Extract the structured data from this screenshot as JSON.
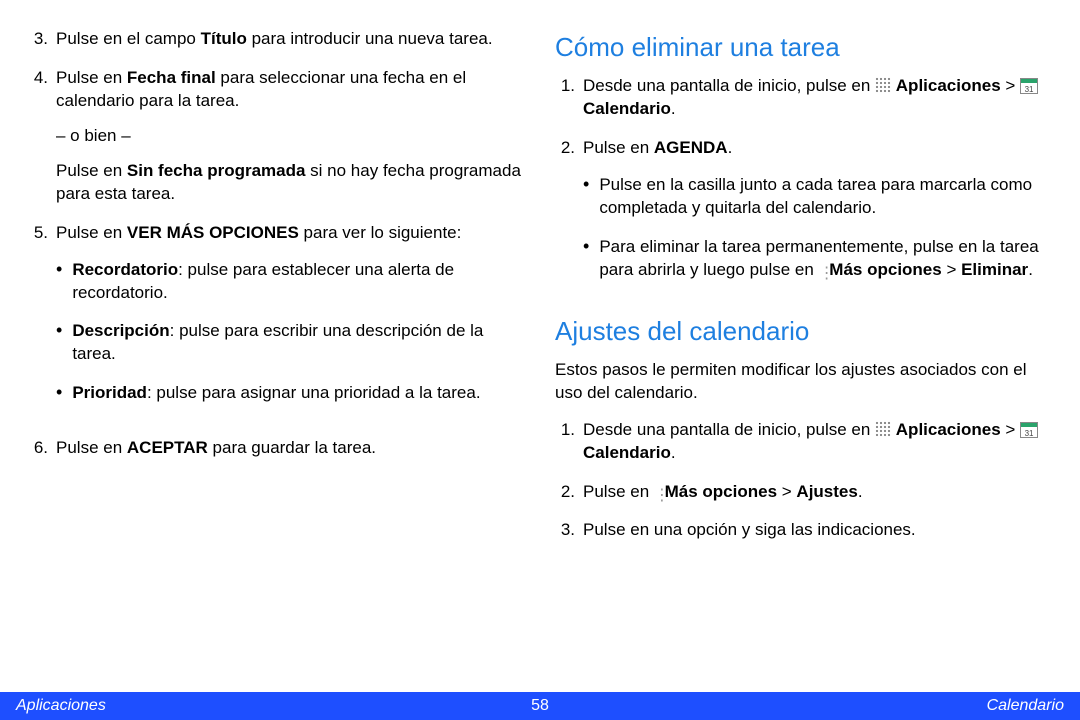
{
  "left": {
    "items": [
      {
        "num": "3.",
        "parts": [
          "Pulse en el campo ",
          {
            "b": "Título"
          },
          " para introducir una nueva tarea."
        ]
      },
      {
        "num": "4.",
        "parts": [
          "Pulse en ",
          {
            "b": "Fecha final"
          },
          " para seleccionar una fecha en el calendario para la tarea."
        ],
        "sub": [
          {
            "parts": [
              "– o bien –"
            ]
          },
          {
            "parts": [
              "Pulse en ",
              {
                "b": "Sin fecha programada"
              },
              " si no hay fecha programada para esta tarea."
            ]
          }
        ]
      },
      {
        "num": "5.",
        "parts": [
          "Pulse en ",
          {
            "b": "VER MÁS OPCIONES"
          },
          " para ver lo siguiente:"
        ],
        "bullets": [
          {
            "parts": [
              {
                "b": "Recordatorio"
              },
              ": pulse para establecer una alerta de recordatorio."
            ]
          },
          {
            "parts": [
              {
                "b": "Descripción"
              },
              ": pulse para escribir una descripción de la tarea."
            ]
          },
          {
            "parts": [
              {
                "b": "Prioridad"
              },
              ": pulse para asignar una prioridad a la tarea."
            ]
          }
        ]
      },
      {
        "num": "6.",
        "parts": [
          "Pulse en ",
          {
            "b": "ACEPTAR"
          },
          " para guardar la tarea."
        ]
      }
    ]
  },
  "right": {
    "h1": "Cómo eliminar una tarea",
    "list1": [
      {
        "num": "1.",
        "parts": [
          "Desde una pantalla de inicio, pulse en ",
          {
            "icon": "apps"
          },
          " ",
          {
            "b": "Aplicaciones"
          },
          " > ",
          {
            "icon": "cal"
          },
          " ",
          {
            "b": "Calendario"
          },
          "."
        ]
      },
      {
        "num": "2.",
        "parts": [
          "Pulse en ",
          {
            "b": "AGENDA"
          },
          "."
        ],
        "bullets": [
          {
            "parts": [
              "Pulse en la casilla junto a cada tarea para marcarla como completada y quitarla del calendario."
            ]
          },
          {
            "parts": [
              "Para eliminar la tarea permanentemente, pulse en la tarea para abrirla y luego pulse en ",
              {
                "icon": "more"
              },
              " ",
              {
                "b": "Más opciones"
              },
              " > ",
              {
                "b": "Eliminar"
              },
              "."
            ]
          }
        ]
      }
    ],
    "h2": "Ajustes del calendario",
    "intro": "Estos pasos le permiten modificar los ajustes asociados con el uso del calendario.",
    "list2": [
      {
        "num": "1.",
        "parts": [
          "Desde una pantalla de inicio, pulse en ",
          {
            "icon": "apps"
          },
          " ",
          {
            "b": "Aplicaciones"
          },
          " > ",
          {
            "icon": "cal"
          },
          " ",
          {
            "b": "Calendario"
          },
          "."
        ]
      },
      {
        "num": "2.",
        "parts": [
          "Pulse en ",
          {
            "icon": "more"
          },
          " ",
          {
            "b": "Más opciones"
          },
          " > ",
          {
            "b": "Ajustes"
          },
          "."
        ]
      },
      {
        "num": "3.",
        "parts": [
          "Pulse en una opción y siga las indicaciones."
        ]
      }
    ]
  },
  "footer": {
    "left": "Aplicaciones",
    "center": "58",
    "right": "Calendario"
  }
}
